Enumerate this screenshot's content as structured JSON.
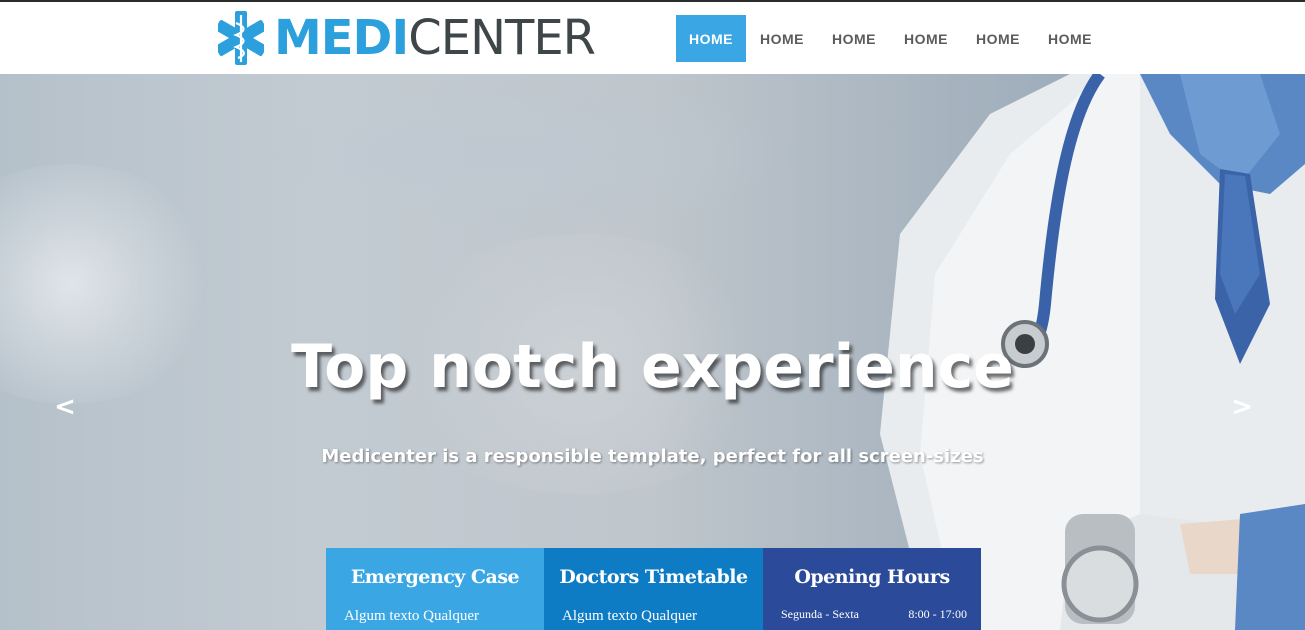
{
  "brand": {
    "part1": "MEDI",
    "part2": "CENTER"
  },
  "nav": {
    "items": [
      "HOME",
      "HOME",
      "HOME",
      "HOME",
      "HOME",
      "HOME"
    ]
  },
  "hero": {
    "title": "Top notch experience",
    "subtitle": "Medicenter is a responsible template, perfect for all screen-sizes",
    "prev": "<",
    "next": ">"
  },
  "boxes": {
    "emergency": {
      "title": "Emergency Case",
      "text": "Algum texto Qualquer"
    },
    "timetable": {
      "title": "Doctors Timetable",
      "text": "Algum texto Qualquer"
    },
    "hours": {
      "title": "Opening Hours",
      "day": "Segunda - Sexta",
      "time": "8:00 - 17:00"
    }
  },
  "colors": {
    "brand": "#2ba0dc",
    "nav_active": "#3aa7e4",
    "box1": "#3aa7e4",
    "box2": "#0e7bc5",
    "box3": "#2b4b9a"
  },
  "icons": {
    "logo": "star-of-life-icon"
  }
}
